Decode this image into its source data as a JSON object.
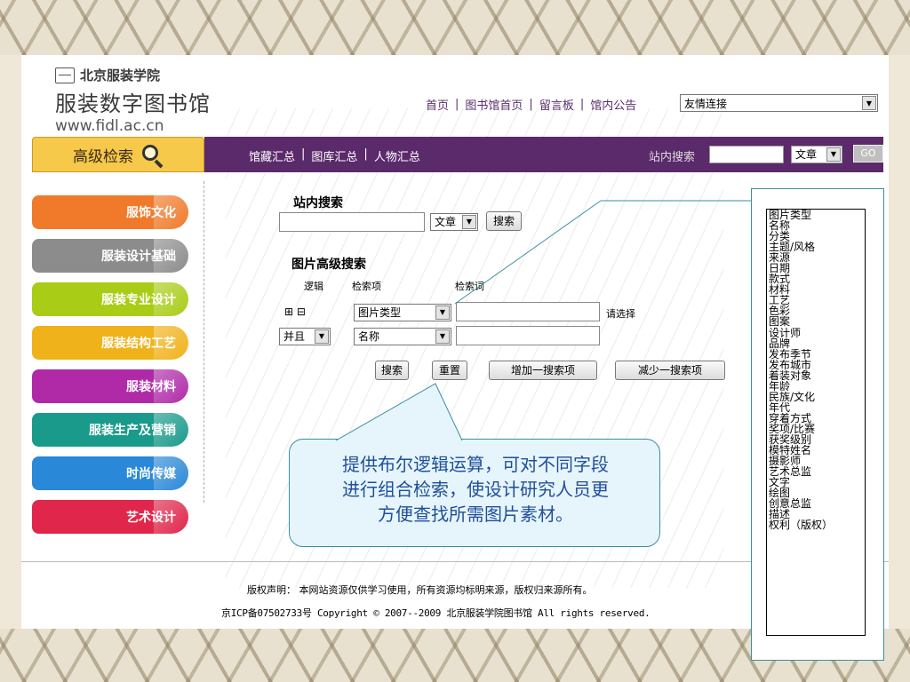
{
  "logo": {
    "school": "北京服装学院",
    "title": "服装数字图书馆",
    "url": "www.fidl.ac.cn"
  },
  "topnav": {
    "items": [
      "首页",
      "图书馆首页",
      "留言板",
      "馆内公告"
    ],
    "separator": "|",
    "friend_links": "友情连接"
  },
  "adv_tab": {
    "label": "高级检索"
  },
  "purplebar": {
    "links": [
      "馆藏汇总",
      "图库汇总",
      "人物汇总"
    ],
    "separator": "|",
    "site_search_label": "站内搜索",
    "type_value": "文章",
    "go_label": "GO"
  },
  "sidebar": {
    "items": [
      {
        "label": "服饰文化",
        "color": "#f07a2a"
      },
      {
        "label": "服装设计基础",
        "color": "#8c8c8c"
      },
      {
        "label": "服装专业设计",
        "color": "#a9cc16"
      },
      {
        "label": "服装结构工艺",
        "color": "#f0b21a"
      },
      {
        "label": "服装材料",
        "color": "#b02aa8"
      },
      {
        "label": "服装生产及营销",
        "color": "#1a9a8a"
      },
      {
        "label": "时尚传媒",
        "color": "#2a88d8"
      },
      {
        "label": "艺术设计",
        "color": "#e0264a"
      }
    ]
  },
  "site_search": {
    "heading": "站内搜索",
    "type_value": "文章",
    "search_label": "搜索"
  },
  "image_search": {
    "heading": "图片高级搜索",
    "col_logic": "逻辑",
    "col_field": "检索项",
    "col_keyword": "检索词",
    "plus_minus": "⊞ ⊟",
    "row1_field": "图片类型",
    "row1_hint": "请选择",
    "row2_logic": "并且",
    "row2_field": "名称",
    "btn_search": "搜索",
    "btn_reset": "重置",
    "btn_add": "增加一搜索项",
    "btn_remove": "减少一搜索项"
  },
  "callout": {
    "line1": "提供布尔逻辑运算，可对不同字段",
    "line2": "进行组合检索，使设计研究人员更",
    "line3": "方便查找所需图片素材。"
  },
  "dropdown": {
    "selected_index": 30,
    "options": [
      "图片类型",
      "名称",
      "分类",
      "主题/风格",
      "来源",
      "日期",
      "款式",
      "材料",
      "工艺",
      "色彩",
      "图案",
      "设计师",
      "品牌",
      "发布季节",
      "发布城市",
      "着装对象",
      "年龄",
      "民族/文化",
      "年代",
      "穿着方式",
      "奖项/比赛",
      "获奖级别",
      "模特姓名",
      "摄影师",
      "艺术总监",
      "文字",
      "绘图",
      "创意总监",
      "描述",
      "权利（版权）"
    ]
  },
  "footer": {
    "copyright": "版权声明： 本网站资源仅供学习使用，所有资源均标明来源，版权归来源所有。",
    "icp": "京ICP备07502733号 Copyright © 2007--2009 北京服装学院图书馆 All rights reserved."
  }
}
